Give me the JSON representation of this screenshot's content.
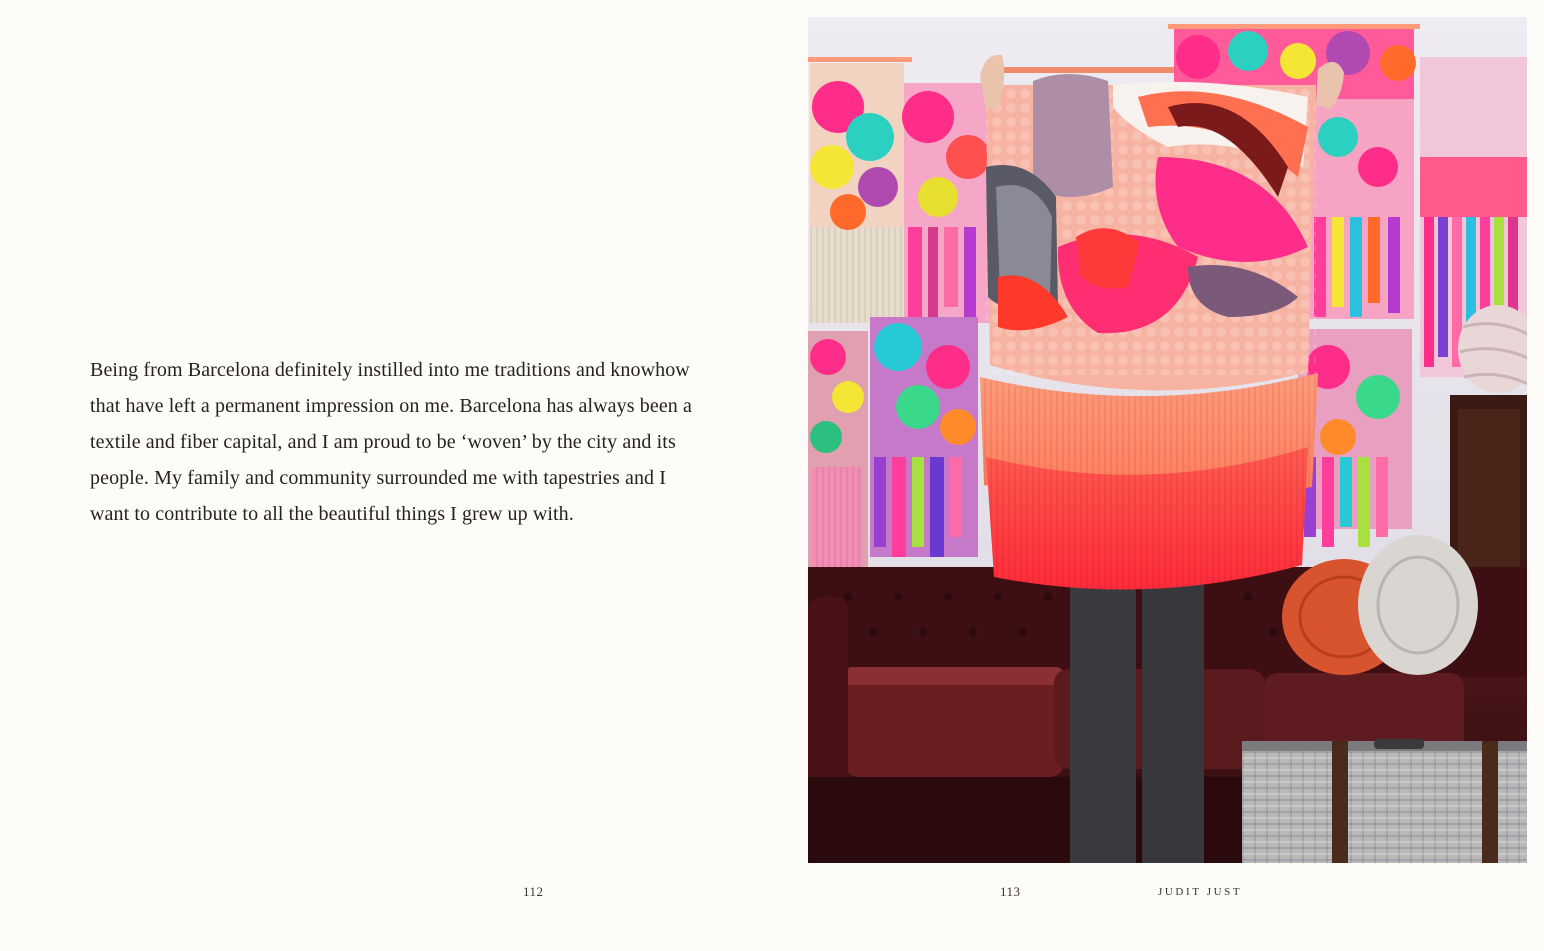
{
  "left_page": {
    "body_text": "Being from Barcelona definitely instilled into me traditions and knowhow that have left a permanent impression on me. Barcelona has always been a textile and fiber capital, and I am proud to be ‘woven’ by the city and its people. My family and community surrounded me with tapestries and I want to contribute to all the beautiful things I grew up with.",
    "page_number": "112"
  },
  "right_page": {
    "page_number": "113",
    "running_head": "JUDIT JUST"
  },
  "colors": {
    "paper": "#fdfcf8",
    "text": "#262220",
    "wall": "#e9e6ef",
    "sofa": "#4a1418",
    "hot_pink": "#ff2d8a",
    "coral": "#ff4a4a",
    "peach": "#f7b3a2"
  }
}
